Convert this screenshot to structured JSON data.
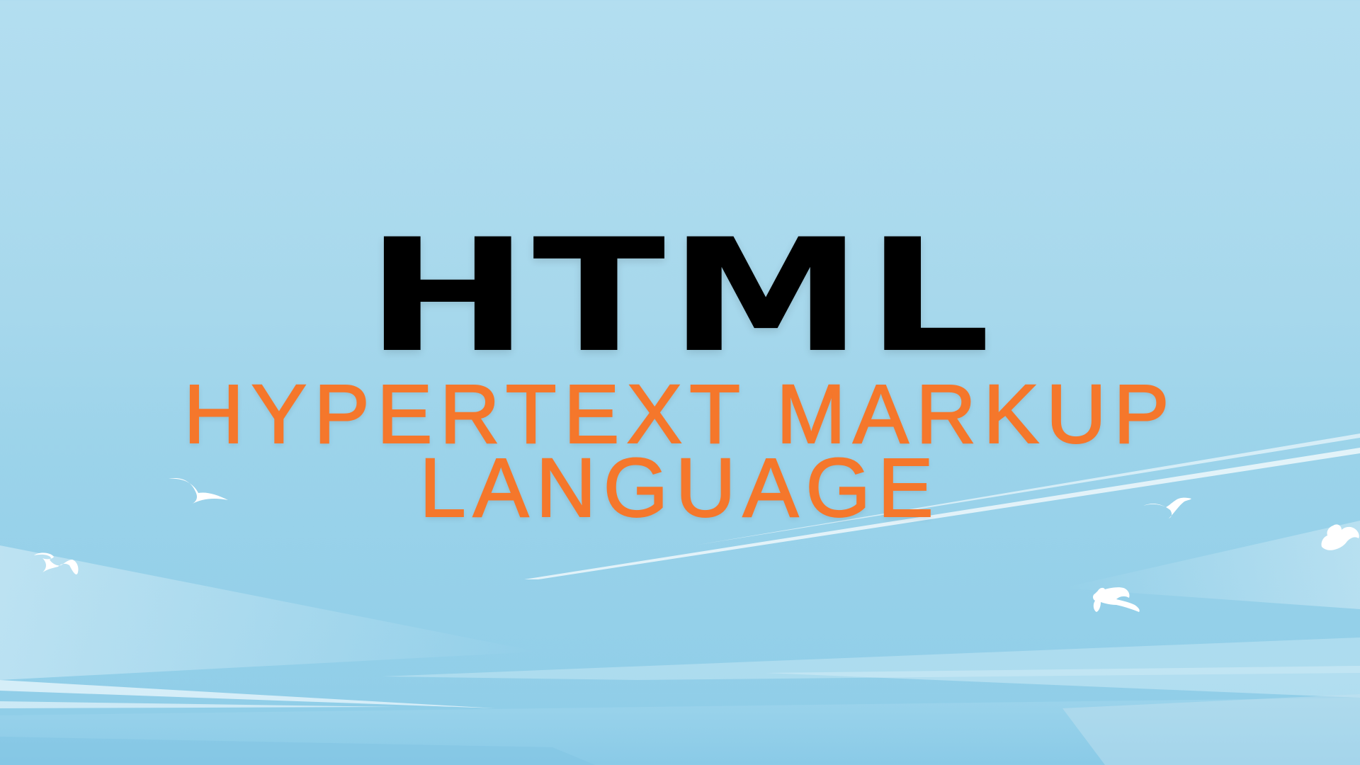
{
  "title": "HTML",
  "subtitle": {
    "line1": "HYPERTEXT MARKUP",
    "line2": "LANGUAGE"
  },
  "colors": {
    "sky_top": "#b3def0",
    "sky_bottom": "#8ecde8",
    "title": "#000000",
    "subtitle": "#f5772b",
    "bird": "#ffffff",
    "streak": "#e4f4fb"
  },
  "decor": {
    "birds": [
      "bird-icon",
      "bird-icon",
      "bird-icon",
      "bird-icon",
      "bird-icon"
    ]
  }
}
